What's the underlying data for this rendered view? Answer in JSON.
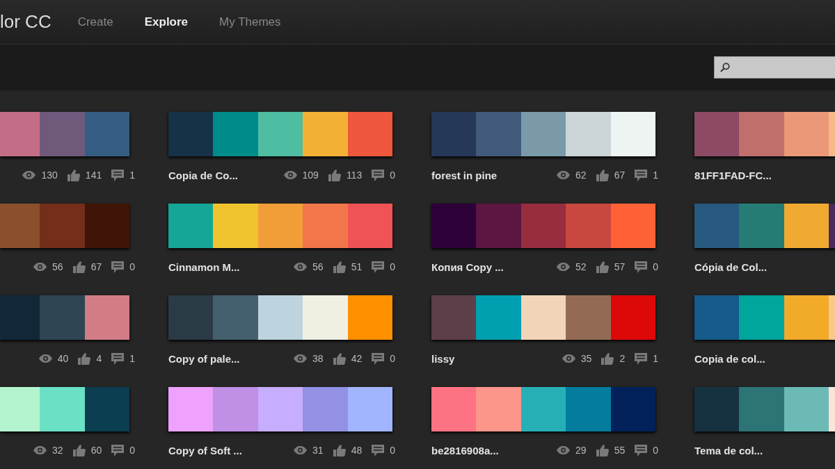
{
  "header": {
    "logo": "lor CC",
    "nav": [
      {
        "label": "Create",
        "selected": false
      },
      {
        "label": "Explore",
        "selected": true
      },
      {
        "label": "My Themes",
        "selected": false
      }
    ]
  },
  "rows": [
    {
      "themes": [
        {
          "swatches": [
            {
              "color": "#c46d87"
            },
            {
              "color": "#6f5a7c"
            },
            {
              "color": "#345d84"
            }
          ],
          "views": "130",
          "likes": "141",
          "comments": "1"
        },
        {
          "title": "Copia de Co...",
          "swatches": [
            {
              "color": "#163246"
            },
            {
              "color": "#008b8b"
            },
            {
              "color": "#4fbda1"
            },
            {
              "color": "#f2b134"
            },
            {
              "color": "#ee573b"
            }
          ],
          "views": "109",
          "likes": "113",
          "comments": "0"
        },
        {
          "title": "forest in pine",
          "swatches": [
            {
              "color": "#263858"
            },
            {
              "color": "#425b7a"
            },
            {
              "color": "#7a9aaa"
            },
            {
              "color": "#ccd6d8"
            },
            {
              "color": "#eef4f2"
            }
          ],
          "views": "62",
          "likes": "67",
          "comments": "1"
        },
        {
          "title": "81FF1FAD-FC...",
          "swatches": [
            {
              "color": "#8c4a64"
            },
            {
              "color": "#c06f6b"
            },
            {
              "color": "#eb9878"
            },
            {
              "color": "#f5b889"
            }
          ]
        }
      ]
    },
    {
      "themes": [
        {
          "swatches": [
            {
              "color": "#8b4f2e"
            },
            {
              "color": "#742e19"
            },
            {
              "color": "#401406"
            }
          ],
          "views": "56",
          "likes": "67",
          "comments": "0"
        },
        {
          "title": "Cinnamon M...",
          "swatches": [
            {
              "color": "#16a697"
            },
            {
              "color": "#f1c32f"
            },
            {
              "color": "#f29e38"
            },
            {
              "color": "#f27649"
            },
            {
              "color": "#f05355"
            }
          ],
          "views": "56",
          "likes": "51",
          "comments": "0"
        },
        {
          "title": "Копия Copy ...",
          "swatches": [
            {
              "color": "#2d0138"
            },
            {
              "color": "#5b1641"
            },
            {
              "color": "#982d40"
            },
            {
              "color": "#c8473e"
            },
            {
              "color": "#ff6136"
            }
          ],
          "views": "52",
          "likes": "57",
          "comments": "0"
        },
        {
          "title": "Cópia de Col...",
          "swatches": [
            {
              "color": "#275a7e"
            },
            {
              "color": "#267c75"
            },
            {
              "color": "#f0aa32"
            },
            {
              "color": "#4a2a5a"
            }
          ]
        }
      ]
    },
    {
      "themes": [
        {
          "swatches": [
            {
              "color": "#112838"
            },
            {
              "color": "#2f4554"
            },
            {
              "color": "#d27d86"
            }
          ],
          "views": "40",
          "likes": "4",
          "comments": "1"
        },
        {
          "title": "Copy of pale...",
          "swatches": [
            {
              "color": "#2a3b46"
            },
            {
              "color": "#44606f"
            },
            {
              "color": "#bdd4df"
            },
            {
              "color": "#f0f0e2"
            },
            {
              "color": "#ff9100"
            }
          ],
          "views": "38",
          "likes": "42",
          "comments": "0"
        },
        {
          "title": "lissy",
          "swatches": [
            {
              "color": "#5d3f49"
            },
            {
              "color": "#00a0b0"
            },
            {
              "color": "#f2d5b8"
            },
            {
              "color": "#936b54"
            },
            {
              "color": "#dd0808"
            }
          ],
          "views": "35",
          "likes": "2",
          "comments": "1"
        },
        {
          "title": "Copia de col...",
          "swatches": [
            {
              "color": "#155b8c"
            },
            {
              "color": "#00a59b"
            },
            {
              "color": "#f2aa29"
            },
            {
              "color": "#f8c98a"
            }
          ]
        }
      ]
    },
    {
      "themes": [
        {
          "swatches": [
            {
              "color": "#b3f4cf"
            },
            {
              "color": "#6ae0c4"
            },
            {
              "color": "#0b3e51"
            }
          ],
          "views": "32",
          "likes": "60",
          "comments": "0"
        },
        {
          "title": "Copy of Soft ...",
          "swatches": [
            {
              "color": "#eea1fd"
            },
            {
              "color": "#c090e6"
            },
            {
              "color": "#c6adfe"
            },
            {
              "color": "#9291e4"
            },
            {
              "color": "#a0b5fe"
            }
          ],
          "views": "31",
          "likes": "48",
          "comments": "0"
        },
        {
          "title": "be2816908a...",
          "swatches": [
            {
              "color": "#fd7383"
            },
            {
              "color": "#fc958a"
            },
            {
              "color": "#26b0b6"
            },
            {
              "color": "#037c9e"
            },
            {
              "color": "#022059"
            }
          ],
          "views": "29",
          "likes": "55",
          "comments": "0"
        },
        {
          "title": "Tema de col...",
          "swatches": [
            {
              "color": "#163240"
            },
            {
              "color": "#2d7477"
            },
            {
              "color": "#6bbab5"
            },
            {
              "color": "#fbe3d7"
            }
          ]
        }
      ]
    }
  ]
}
